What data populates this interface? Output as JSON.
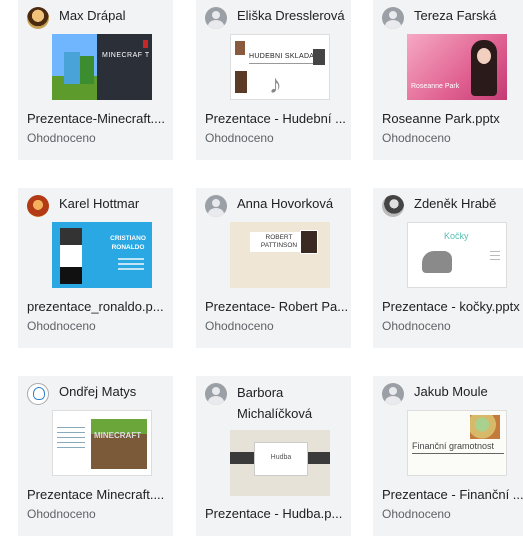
{
  "cards": [
    {
      "name": "Max Drápal",
      "title": "Prezentace-Minecraft....",
      "status": "Ohodnoceno",
      "thumb_text": "MINECRAF T"
    },
    {
      "name": "Eliška Dresslerová",
      "title": "Prezentace - Hudební ...",
      "status": "Ohodnoceno",
      "thumb_text": "HUDEBNÍ SKLADATELÉ"
    },
    {
      "name": "Tereza Farská",
      "title": "Roseanne Park.pptx",
      "status": "Ohodnoceno",
      "thumb_text": "Roseanne Park"
    },
    {
      "name": "Karel Hottmar",
      "title": "prezentace_ronaldo.p...",
      "status": "Ohodnoceno",
      "thumb_text": "CRISTIANO RONALDO"
    },
    {
      "name": "Anna Hovorková",
      "title": "Prezentace- Robert Pa...",
      "status": "Ohodnoceno",
      "thumb_text": "ROBERT PATTINSON"
    },
    {
      "name": "Zdeněk Hrabě",
      "title": "Prezentace - kočky.pptx",
      "status": "Ohodnoceno",
      "thumb_text": "Kočky"
    },
    {
      "name": "Ondřej Matys",
      "title": "Prezentace Minecraft....",
      "status": "Ohodnoceno",
      "thumb_text": "MINECRAFT"
    },
    {
      "name": "Barbora Michalíčková",
      "title": "Prezentace - Hudba.p...",
      "status": "",
      "thumb_text": "Hudba"
    },
    {
      "name": "Jakub Moule",
      "title": "Prezentace - Finanční ...",
      "status": "Ohodnoceno",
      "thumb_text": "Finanční gramotnost"
    }
  ]
}
